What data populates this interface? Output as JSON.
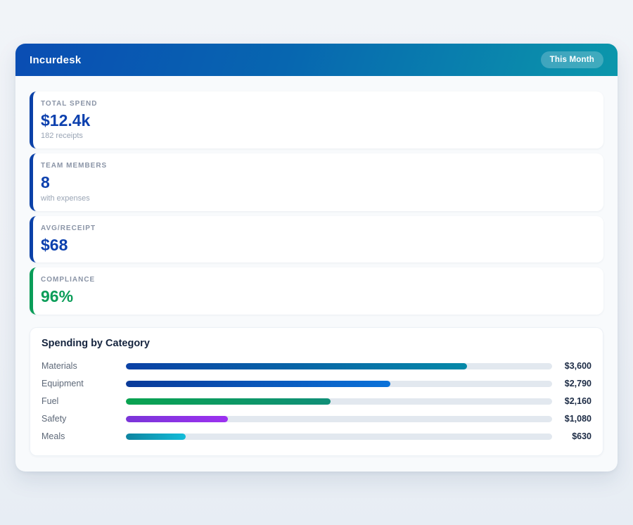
{
  "header": {
    "title": "Incurdesk",
    "badge": "This Month"
  },
  "stats": [
    {
      "label": "TOTAL SPEND",
      "value": "$12.4k",
      "subtext": "182 receipts",
      "accent_color": "#0b41a8",
      "value_color": "#0c40ae"
    },
    {
      "label": "TEAM MEMBERS",
      "value": "8",
      "subtext": "with expenses",
      "accent_color": "#0b41a8",
      "value_color": "#0c40ae"
    },
    {
      "label": "AVG/RECEIPT",
      "value": "$68",
      "subtext": "",
      "accent_color": "#0b41a8",
      "value_color": "#0c40ae"
    },
    {
      "label": "COMPLIANCE",
      "value": "96%",
      "subtext": "",
      "accent_color": "#0a9d58",
      "value_color": "#0a9d58"
    }
  ],
  "chart_data": {
    "type": "bar",
    "orientation": "horizontal",
    "title": "Spending by Category",
    "categories": [
      "Materials",
      "Equipment",
      "Fuel",
      "Safety",
      "Meals"
    ],
    "values": [
      3600,
      2790,
      2160,
      1080,
      630
    ],
    "value_labels": [
      "$3,600",
      "$2,790",
      "$2,160",
      "$1,080",
      "$630"
    ],
    "scale_max": 4500,
    "track_color": "#e2e8ef",
    "bar_gradients": [
      [
        "#0b41a6",
        "#0689a8"
      ],
      [
        "#0a3a99",
        "#0b72d9"
      ],
      [
        "#09a350",
        "#108f78"
      ],
      [
        "#7a35d8",
        "#9c31f0"
      ],
      [
        "#0e84a0",
        "#13bcd9"
      ]
    ],
    "legend": false,
    "grid": false
  },
  "colors": {
    "header_gradient_start": "#0a4db3",
    "header_gradient_end": "#0b97ab",
    "page_background": "#eef1f6",
    "container_background": "#f8fafc",
    "card_background": "#ffffff",
    "accent_blue": "#0b41a8",
    "accent_green": "#0a9d58",
    "label_gray": "#8a94a6",
    "value_navy": "#1b2a44"
  }
}
